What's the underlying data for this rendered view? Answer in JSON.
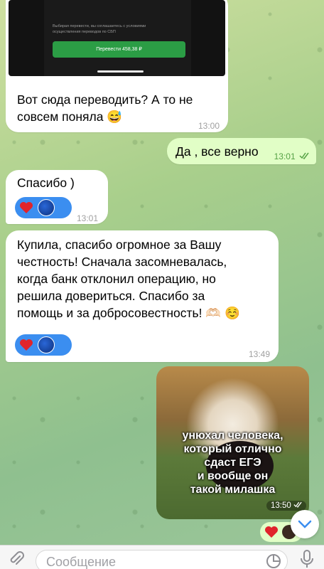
{
  "quoted_screenshot": {
    "consent_text": "Выбирая перевести, вы соглашаетесь с условиями осуществления переводов по СБП",
    "transfer_button_label": "Перевести 458,38 ₽"
  },
  "messages": [
    {
      "text_line1": "Вот сюда переводить? А то не",
      "text_line2": "совсем поняла 😅",
      "time": "13:00"
    },
    {
      "text": "Да , все верно",
      "time": "13:01"
    },
    {
      "text": "Спасибо )",
      "time": "13:01"
    },
    {
      "line1": "Купила, спасибо огромное за Вашу",
      "line2": "честность! Сначала засомневалась,",
      "line3": "когда банк отклонил операцию, но",
      "line4": "решила довериться. Спасибо за",
      "line5": "помощь и за добросовестность! 🫶🏻 ☺️",
      "time": "13:49"
    }
  ],
  "photo_caption": {
    "line1": "унюхал человека,",
    "line2": "который отлично",
    "line3": "сдаст ЕГЭ",
    "line4": "и вообще он",
    "line5": "такой милашка",
    "time": "13:50"
  },
  "composer": {
    "placeholder": "Сообщение"
  },
  "colors": {
    "accent": "#3b8ef0",
    "outgoing": "#e1fec6",
    "heart": "#e0242b"
  }
}
